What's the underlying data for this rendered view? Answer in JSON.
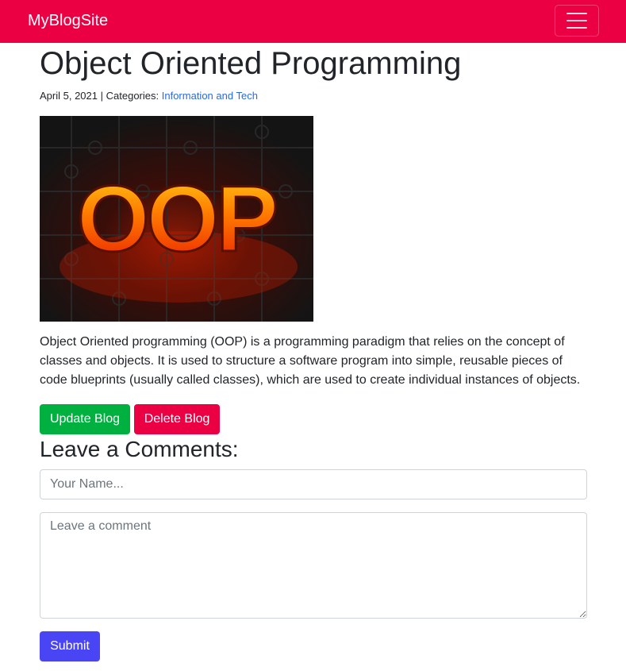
{
  "navbar": {
    "brand": "MyBlogSite",
    "bg_color": "#eb0043",
    "toggler_icon": "hamburger-menu-icon"
  },
  "post": {
    "title": "Object Oriented Programming",
    "date": "April 5, 2021",
    "separator": "|",
    "categories_label": "Categories:",
    "category": "Information and Tech",
    "image_text": "OOP",
    "body": "Object Oriented programming (OOP) is a programming paradigm that relies on the concept of classes and objects. It is used to structure a software program into simple, reusable pieces of code blueprints (usually called classes), which are used to create individual instances of objects."
  },
  "actions": {
    "update_label": "Update Blog",
    "delete_label": "Delete Blog",
    "update_color": "#00b140",
    "delete_color": "#eb0043"
  },
  "comments": {
    "heading": "Leave a Comments:",
    "name_placeholder": "Your Name...",
    "comment_placeholder": "Leave a comment",
    "submit_label": "Submit",
    "submit_color": "#4a45f4"
  }
}
